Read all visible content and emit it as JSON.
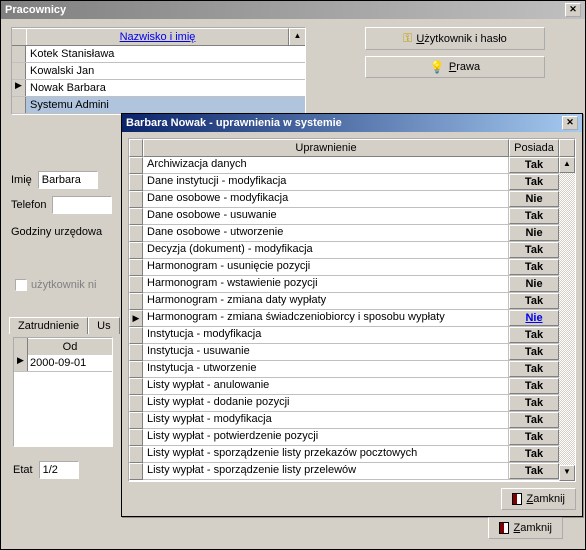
{
  "back_window": {
    "title": "Pracownicy",
    "list": {
      "header": "Nazwisko i imię",
      "rows": [
        {
          "name": "Kotek Stanisława",
          "selected": false,
          "marker": ""
        },
        {
          "name": "Kowalski Jan",
          "selected": false,
          "marker": ""
        },
        {
          "name": "Nowak Barbara",
          "selected": false,
          "marker": "▶"
        },
        {
          "name": "Systemu Admini",
          "selected": true,
          "marker": ""
        }
      ]
    },
    "buttons": {
      "user_pass": "Użytkownik i hasło",
      "user_pass_hotkey": "U",
      "rights": "Prawa",
      "rights_hotkey": "P"
    },
    "fields": {
      "imie_label": "Imię",
      "imie_value": "Barbara",
      "telefon_label": "Telefon",
      "telefon_value": "",
      "godziny_label": "Godziny urzędowa",
      "uzytkownik_label": "użytkownik ni"
    },
    "tabs": {
      "zatrudnienie": "Zatrudnienie",
      "us": "Us"
    },
    "zatr": {
      "header": "Od",
      "row": "2000-09-01"
    },
    "etat": {
      "label": "Etat",
      "value": "1/2"
    },
    "close_btn": "Zamknij",
    "close_hotkey": "Z"
  },
  "perm_window": {
    "title": "Barbara Nowak - uprawnienia w systemie",
    "headers": {
      "uprawnienie": "Uprawnienie",
      "posiada": "Posiada"
    },
    "rows": [
      {
        "label": "Archiwizacja danych",
        "value": "Tak"
      },
      {
        "label": "Dane instytucji - modyfikacja",
        "value": "Tak"
      },
      {
        "label": "Dane osobowe - modyfikacja",
        "value": "Nie"
      },
      {
        "label": "Dane osobowe - usuwanie",
        "value": "Tak"
      },
      {
        "label": "Dane osobowe - utworzenie",
        "value": "Nie"
      },
      {
        "label": "Decyzja (dokument) - modyfikacja",
        "value": "Tak"
      },
      {
        "label": "Harmonogram - usunięcie pozycji",
        "value": "Tak"
      },
      {
        "label": "Harmonogram - wstawienie pozycji",
        "value": "Nie"
      },
      {
        "label": "Harmonogram - zmiana daty wypłaty",
        "value": "Tak"
      },
      {
        "label": "Harmonogram - zmiana świadczeniobiorcy i sposobu wypłaty",
        "value": "Nie",
        "selected": true
      },
      {
        "label": "Instytucja - modyfikacja",
        "value": "Tak"
      },
      {
        "label": "Instytucja - usuwanie",
        "value": "Tak"
      },
      {
        "label": "Instytucja - utworzenie",
        "value": "Tak"
      },
      {
        "label": "Listy wypłat - anulowanie",
        "value": "Tak"
      },
      {
        "label": "Listy wypłat - dodanie pozycji",
        "value": "Tak"
      },
      {
        "label": "Listy wypłat - modyfikacja",
        "value": "Tak"
      },
      {
        "label": "Listy wypłat - potwierdzenie pozycji",
        "value": "Tak"
      },
      {
        "label": "Listy wypłat - sporządzenie listy przekazów pocztowych",
        "value": "Tak"
      },
      {
        "label": "Listy wypłat - sporządzenie listy przelewów",
        "value": "Tak"
      }
    ],
    "close_btn": "Zamknij",
    "close_hotkey": "Z"
  }
}
